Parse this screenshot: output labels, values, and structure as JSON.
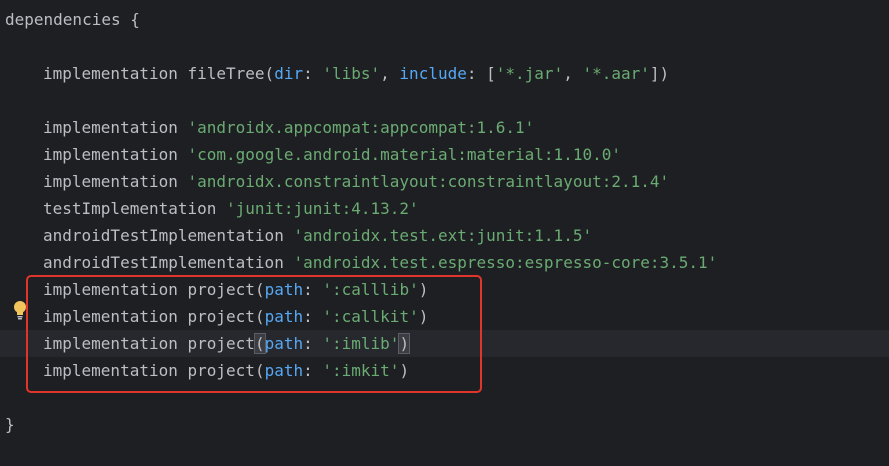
{
  "code": {
    "l1": {
      "kw": "dependencies",
      "brace": " {"
    },
    "l2": {
      "kw": "implementation",
      "fn": " fileTree(",
      "p1": "dir",
      "c1": ": ",
      "s1": "'libs'",
      "sep": ", ",
      "p2": "include",
      "c2": ": [",
      "s2": "'*.jar'",
      "sep2": ", ",
      "s3": "'*.aar'",
      "end": "])"
    },
    "deps": [
      {
        "kw": "implementation",
        "str": "'androidx.appcompat:appcompat:1.6.1'"
      },
      {
        "kw": "implementation",
        "str": "'com.google.android.material:material:1.10.0'"
      },
      {
        "kw": "implementation",
        "str": "'androidx.constraintlayout:constraintlayout:2.1.4'"
      },
      {
        "kw": "testImplementation",
        "str": "'junit:junit:4.13.2'"
      },
      {
        "kw": "androidTestImplementation",
        "str": "'androidx.test.ext:junit:1.1.5'"
      },
      {
        "kw": "androidTestImplementation",
        "str": "'androidx.test.espresso:espresso-core:3.5.1'"
      }
    ],
    "projects": [
      {
        "kw": "implementation",
        "fn": "project",
        "open": "(",
        "param": "path",
        "colon": ": ",
        "str": "':calllib'",
        "close": ")"
      },
      {
        "kw": "implementation",
        "fn": "project",
        "open": "(",
        "param": "path",
        "colon": ": ",
        "str": "':callkit'",
        "close": ")"
      },
      {
        "kw": "implementation",
        "fn": "project",
        "open": "(",
        "param": "path",
        "colon": ": ",
        "str": "':imlib'",
        "close": ")"
      },
      {
        "kw": "implementation",
        "fn": "project",
        "open": "(",
        "param": "path",
        "colon": ": ",
        "str": "':imkit'",
        "close": ")"
      }
    ],
    "closing": "}"
  },
  "colors": {
    "background": "#1e1f22",
    "text": "#bcbec4",
    "string": "#6aab73",
    "named_param": "#56a8f5",
    "highlight_box": "#e0352b",
    "bulb": "#f2c55c"
  }
}
